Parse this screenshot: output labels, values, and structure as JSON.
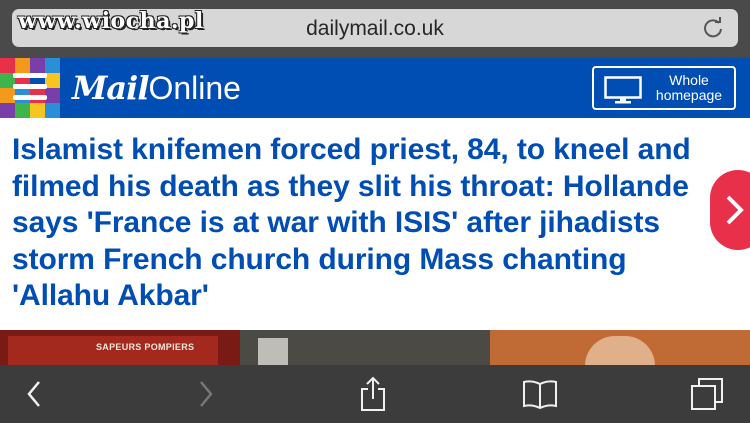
{
  "browser": {
    "url": "dailymail.co.uk",
    "watermark": "www.wiocha.pl"
  },
  "header": {
    "brand_mail": "Mail",
    "brand_online": "Online",
    "homepage_label": "Whole homepage",
    "logo_colors": [
      "#e8304a",
      "#f39a1d",
      "#7a3ea8",
      "#2a8fd6",
      "#3db54a",
      "#e8304a",
      "#004db3",
      "#f7c51f",
      "#f39a1d",
      "#2a8fd6",
      "#e8304a",
      "#7a3ea8",
      "#7a3ea8",
      "#3db54a",
      "#f7c51f",
      "#2a8fd6"
    ],
    "background_color": "#004db3"
  },
  "article": {
    "headline": "Islamist knifemen forced priest, 84, to kneel and filmed his death as they slit his throat: Hollande says 'France is at war with ISIS' after jihadists storm French church during Mass chanting 'Allahu Akbar'",
    "headline_color": "#004db3",
    "photo_sign_text": "SAPEURS POMPIERS"
  },
  "toolbar": {
    "back_icon": "chevron-left-icon",
    "forward_icon": "chevron-right-icon",
    "share_icon": "share-icon",
    "bookmarks_icon": "book-icon",
    "tabs_icon": "tabs-icon"
  }
}
